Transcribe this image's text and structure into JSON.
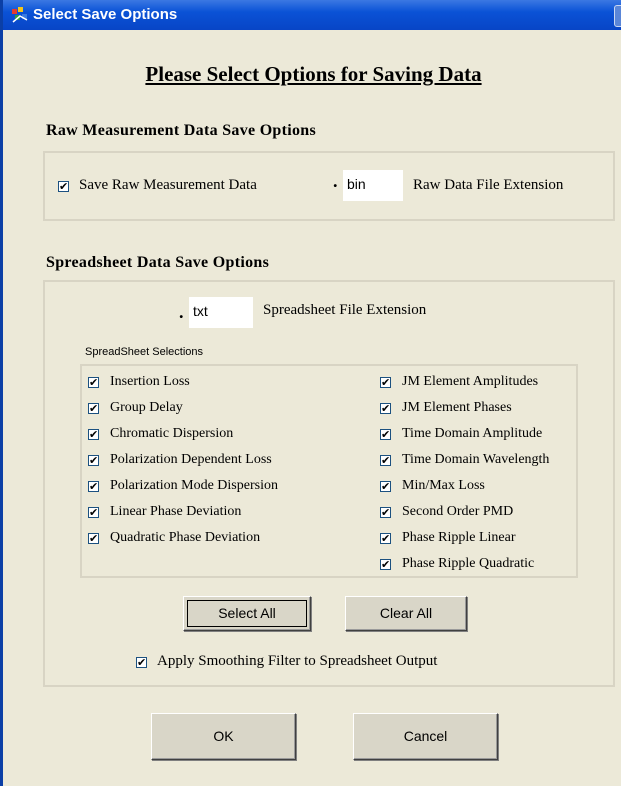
{
  "window": {
    "title": "Select Save Options",
    "icon": "app-icon"
  },
  "heading": "Please Select Options for Saving Data",
  "raw": {
    "section_title": "Raw Measurement Data Save Options",
    "save_label": "Save Raw Measurement Data",
    "save_checked": true,
    "dot": ".",
    "extension_value": "bin",
    "extension_label": "Raw Data File Extension"
  },
  "spreadsheet": {
    "section_title": "Spreadsheet Data Save Options",
    "dot": ".",
    "extension_value": "txt",
    "extension_label": "Spreadsheet File Extension",
    "selections_label": "SpreadSheet Selections",
    "left_items": [
      "Insertion Loss",
      "Group Delay",
      "Chromatic Dispersion",
      "Polarization Dependent Loss",
      "Polarization Mode Dispersion",
      "Linear Phase Deviation",
      "Quadratic Phase Deviation"
    ],
    "right_items": [
      "JM Element Amplitudes",
      "JM Element Phases",
      "Time Domain Amplitude",
      "Time Domain Wavelength",
      "Min/Max Loss",
      "Second Order PMD",
      "Phase Ripple Linear",
      "Phase Ripple Quadratic"
    ],
    "check_mark": "✔",
    "select_all_label": "Select All",
    "clear_all_label": "Clear All",
    "smoothing_label": "Apply Smoothing Filter to Spreadsheet Output",
    "smoothing_checked": true
  },
  "buttons": {
    "ok_label": "OK",
    "cancel_label": "Cancel"
  }
}
